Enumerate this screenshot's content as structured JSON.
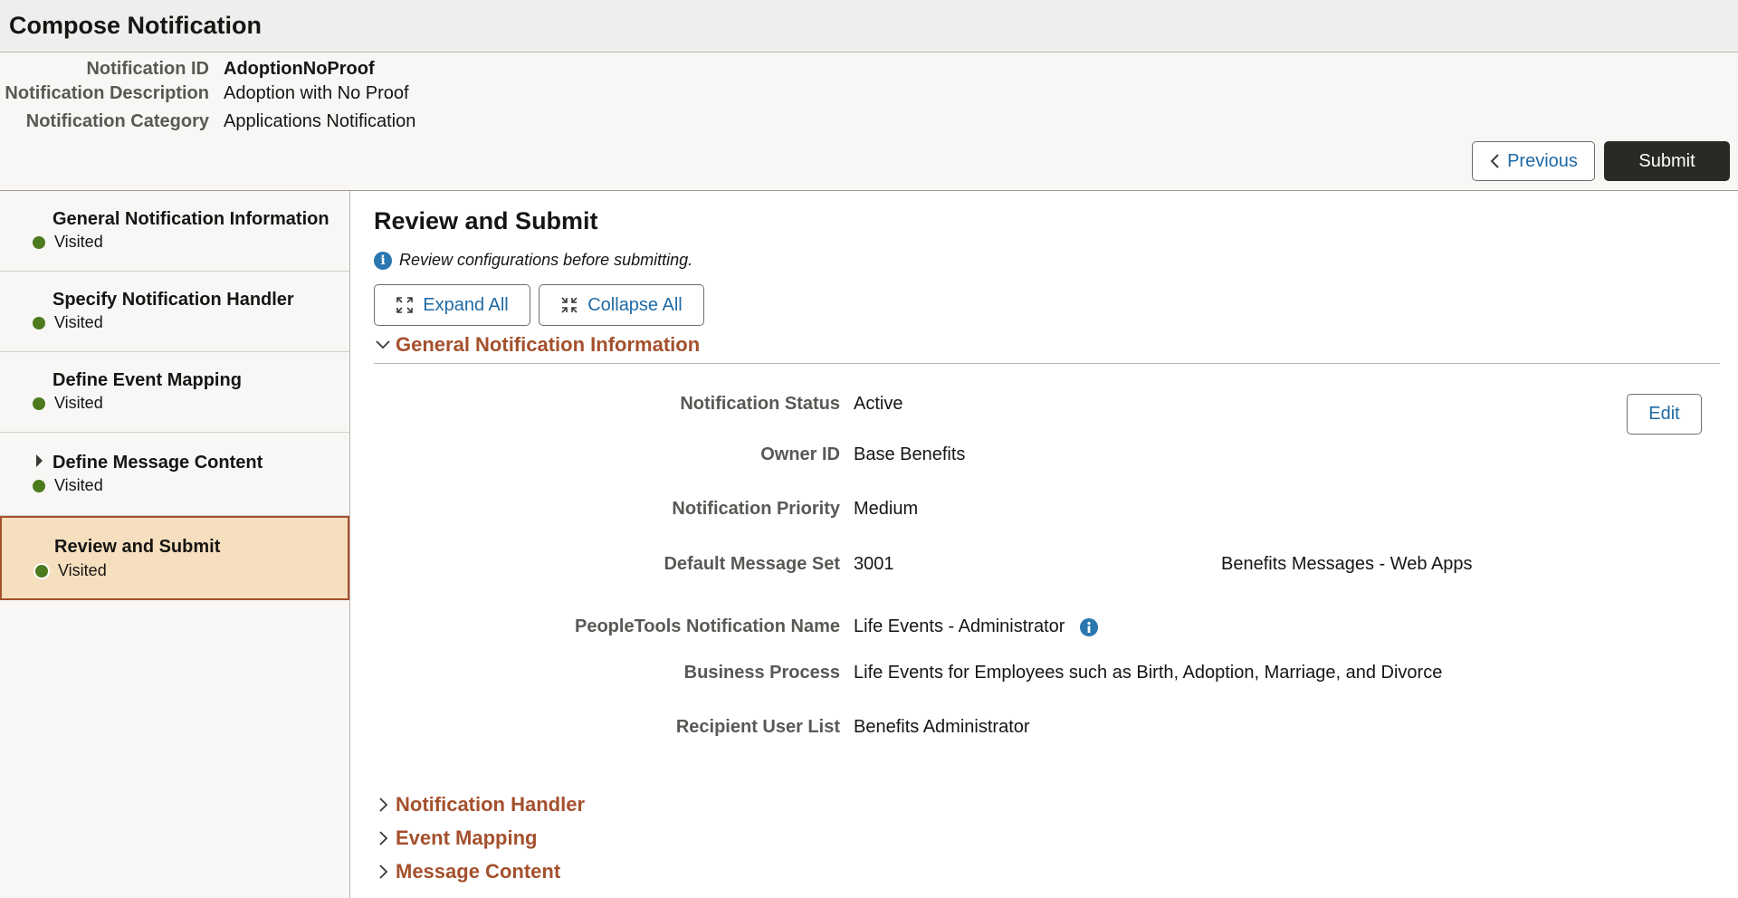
{
  "page": {
    "title": "Compose Notification"
  },
  "header": {
    "id_label": "Notification ID",
    "id_value": "AdoptionNoProof",
    "desc_label": "Notification Description",
    "desc_value": "Adoption with No Proof",
    "cat_label": "Notification Category",
    "cat_value": "Applications Notification"
  },
  "actions": {
    "previous": "Previous",
    "submit": "Submit"
  },
  "steps": [
    {
      "title": "General Notification Information",
      "status": "Visited"
    },
    {
      "title": "Specify Notification Handler",
      "status": "Visited"
    },
    {
      "title": "Define Event Mapping",
      "status": "Visited"
    },
    {
      "title": "Define Message Content",
      "status": "Visited"
    },
    {
      "title": "Review and Submit",
      "status": "Visited"
    }
  ],
  "main": {
    "title": "Review and Submit",
    "info": "Review configurations before submitting.",
    "expand_all": "Expand All",
    "collapse_all": "Collapse All",
    "edit": "Edit"
  },
  "sections": {
    "general": "General Notification Information",
    "handler": "Notification Handler",
    "event": "Event Mapping",
    "message": "Message Content"
  },
  "fields": {
    "status_label": "Notification Status",
    "status_value": "Active",
    "owner_label": "Owner ID",
    "owner_value": "Base Benefits",
    "priority_label": "Notification Priority",
    "priority_value": "Medium",
    "msgset_label": "Default Message Set",
    "msgset_value": "3001",
    "msgset_desc": "Benefits Messages - Web Apps",
    "pt_label": "PeopleTools Notification Name",
    "pt_value": "Life Events - Administrator",
    "bp_label": "Business Process",
    "bp_value": "Life Events for Employees such as Birth, Adoption, Marriage, and Divorce",
    "recip_label": "Recipient User List",
    "recip_value": "Benefits Administrator"
  },
  "colors": {
    "accent": "#a4502c",
    "link": "#1f6aa5",
    "visited_dot": "#4c7a1e",
    "active_step_bg": "#f6dfbf"
  }
}
